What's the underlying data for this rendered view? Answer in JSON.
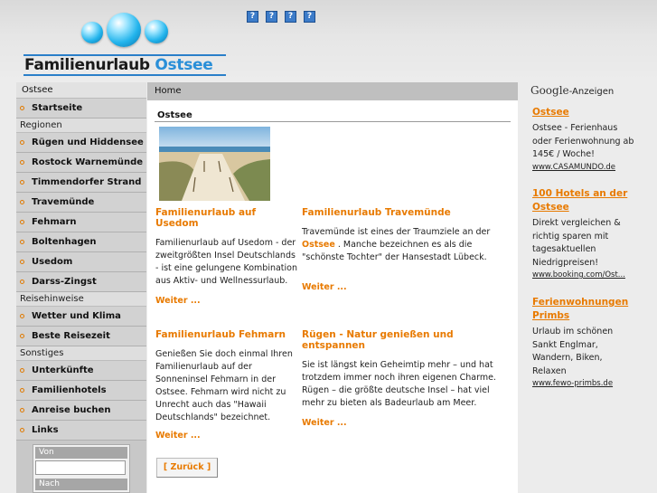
{
  "header": {
    "logo_part1": "Familienurlaub",
    "logo_part2": "Ostsee",
    "icons": [
      "?",
      "?",
      "?",
      "?"
    ]
  },
  "sidebar": {
    "title": "Ostsee",
    "start": "Startseite",
    "cat_regionen": "Regionen",
    "regionen": [
      "Rügen und Hiddensee",
      "Rostock Warnemünde",
      "Timmendorfer Strand",
      "Travemünde",
      "Fehmarn",
      "Boltenhagen",
      "Usedom",
      "Darss-Zingst"
    ],
    "cat_reise": "Reisehinweise",
    "reise": [
      "Wetter und Klima",
      "Beste Reisezeit"
    ],
    "cat_sonstiges": "Sonstiges",
    "sonstiges": [
      "Unterkünfte",
      "Familienhotels",
      "Anreise buchen",
      "Links"
    ],
    "form_from": "Von",
    "form_to": "Nach"
  },
  "main": {
    "breadcrumb": "Home",
    "section": "Ostsee",
    "articles": [
      {
        "title": "Familienurlaub auf Usedom",
        "text": "Familienurlaub auf Usedom - der zweitgrößten Insel Deutschlands - ist eine gelungene Kombination aus Aktiv- und Wellnessurlaub.",
        "more": "Weiter ..."
      },
      {
        "title": "Familienurlaub Travemünde",
        "text_a": "Travemünde ist eines der Traumziele an der",
        "text_hl": "Ostsee",
        "text_b": ". Manche bezeichnen es als die \"schönste Tochter\" der Hansestadt Lübeck.",
        "more": "Weiter ..."
      },
      {
        "title": "Familienurlaub Fehmarn",
        "text": "Genießen Sie doch einmal Ihren Familienurlaub auf der Sonneninsel Fehmarn in der Ostsee. Fehmarn wird nicht zu Unrecht auch das \"Hawaii Deutschlands\" bezeichnet.",
        "more": "Weiter ..."
      },
      {
        "title": "Rügen - Natur genießen und entspannen",
        "text": "Sie ist längst kein Geheimtip mehr – und hat trotzdem immer noch ihren eigenen Charme. Rügen – die größte deutsche Insel – hat viel mehr zu bieten als Badeurlaub am Meer.",
        "more": "Weiter ..."
      }
    ],
    "back": "[ Zurück ]"
  },
  "ads": {
    "google": "Google",
    "label": "-Anzeigen",
    "items": [
      {
        "title": "Ostsee",
        "text": "Ostsee - Ferienhaus oder Ferienwohnung ab 145€ / Woche!",
        "url": "www.CASAMUNDO.de"
      },
      {
        "title": "100 Hotels an der Ostsee",
        "text": "Direkt vergleichen & richtig sparen mit tagesaktuellen Niedrigpreisen!",
        "url": "www.booking.com/Ost..."
      },
      {
        "title": "Ferienwohnungen Primbs",
        "text": "Urlaub im schönen Sankt Englmar, Wandern, Biken, Relaxen",
        "url": "www.fewo-primbs.de"
      }
    ]
  },
  "colors": {
    "accent": "#e87a00",
    "logo_blue": "#2a8fd8"
  }
}
